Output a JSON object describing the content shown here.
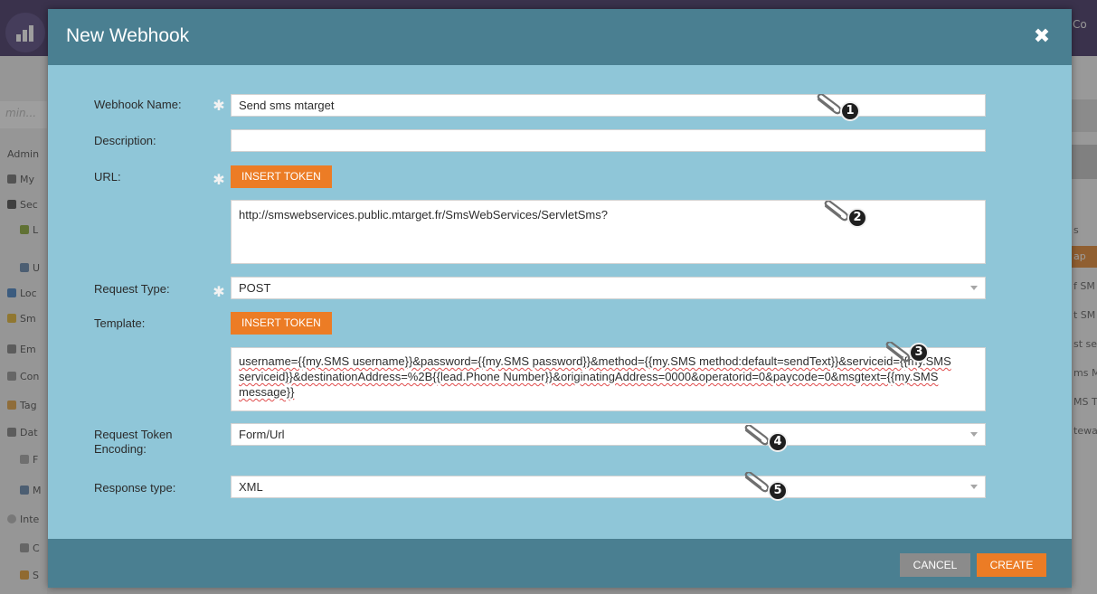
{
  "modal": {
    "title": "New Webhook",
    "close_label": "✖"
  },
  "form": {
    "webhook_name": {
      "label": "Webhook Name:",
      "value": "Send sms mtarget",
      "required": true
    },
    "description": {
      "label": "Description:",
      "value": ""
    },
    "url": {
      "label": "URL:",
      "required": true,
      "insert_token_label": "INSERT TOKEN",
      "value": "http://smswebservices.public.mtarget.fr/SmsWebServices/ServletSms?"
    },
    "request_type": {
      "label": "Request Type:",
      "value": "POST",
      "required": true
    },
    "template": {
      "label": "Template:",
      "insert_token_label": "INSERT TOKEN",
      "value": "username={{my.SMS username}}&password={{my.SMS password}}&method={{my.SMS method:default=sendText}}&serviceid={{my.SMS serviceid}}&destinationAddress=%2B{{lead.Phone Number}}&originatingAddress=0000&operatorid=0&paycode=0&msgtext={{my.SMS message}}"
    },
    "request_token_encoding": {
      "label": "Request Token Encoding:",
      "value": "Form/Url"
    },
    "response_type": {
      "label": "Response type:",
      "value": "XML"
    }
  },
  "markers": [
    "1",
    "2",
    "3",
    "4",
    "5"
  ],
  "footer": {
    "cancel_label": "CANCEL",
    "create_label": "CREATE"
  },
  "colors": {
    "modal_header": "#4a7f91",
    "modal_body": "#8fc6d8",
    "accent_orange": "#ec7c25",
    "cancel_grey": "#8b8b8b"
  }
}
